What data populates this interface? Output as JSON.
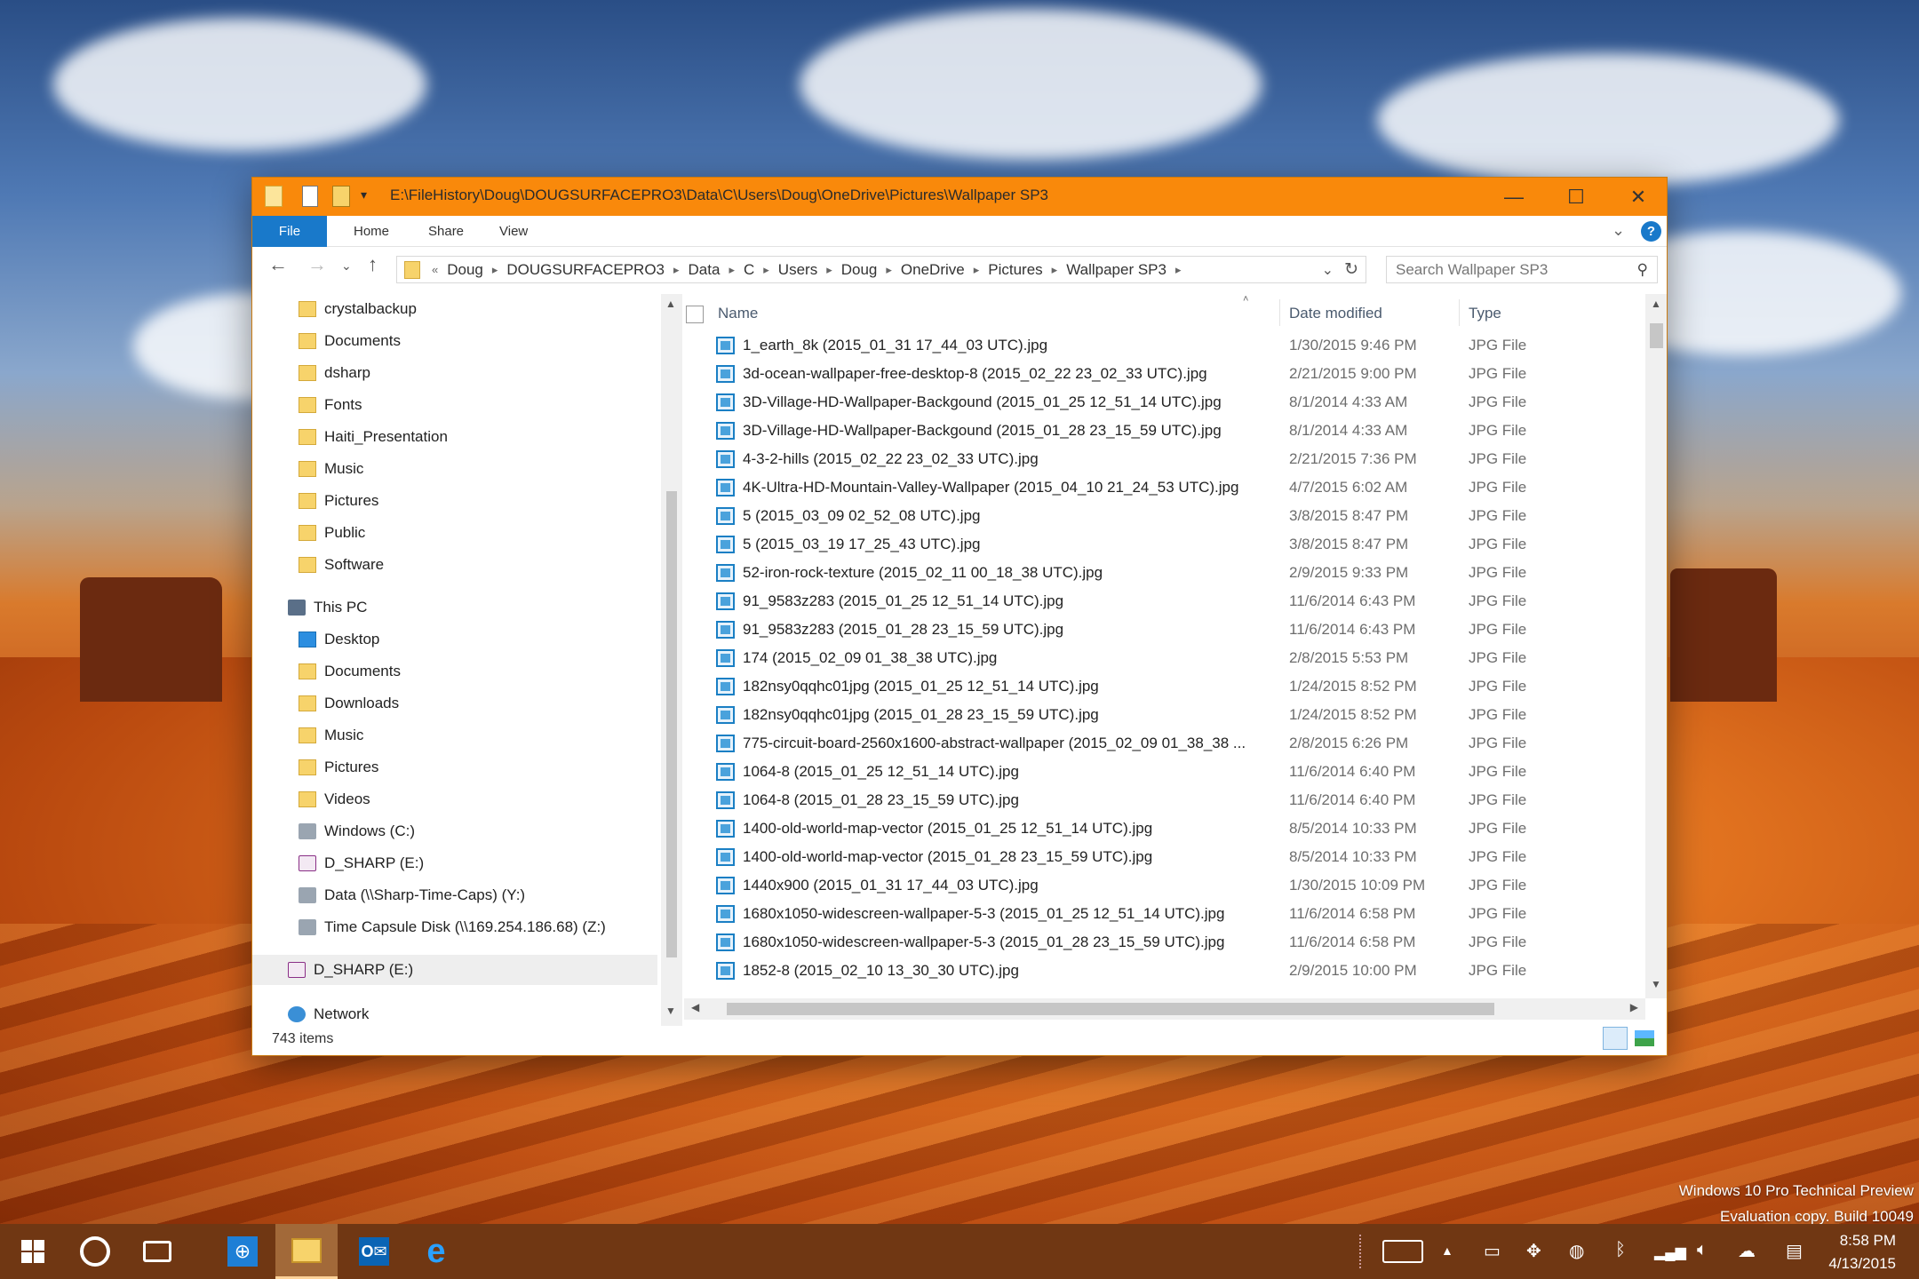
{
  "window": {
    "title_path": "E:\\FileHistory\\Doug\\DOUGSURFACEPRO3\\Data\\C\\Users\\Doug\\OneDrive\\Pictures\\Wallpaper SP3",
    "controls": {
      "minimize": "—",
      "maximize": "☐",
      "close": "✕"
    }
  },
  "ribbon": {
    "tabs": [
      "File",
      "Home",
      "Share",
      "View"
    ],
    "help": "?"
  },
  "address": {
    "overflow": "«",
    "crumbs": [
      "Doug",
      "DOUGSURFACEPRO3",
      "Data",
      "C",
      "Users",
      "Doug",
      "OneDrive",
      "Pictures",
      "Wallpaper SP3"
    ],
    "search_placeholder": "Search Wallpaper SP3"
  },
  "nav": {
    "folders": [
      "crystalbackup",
      "Documents",
      "dsharp",
      "Fonts",
      "Haiti_Presentation",
      "Music",
      "Pictures",
      "Public",
      "Software"
    ],
    "this_pc": "This PC",
    "pc_items": [
      "Desktop",
      "Documents",
      "Downloads",
      "Music",
      "Pictures",
      "Videos"
    ],
    "drives": [
      "Windows (C:)",
      "D_SHARP (E:)",
      "Data (\\\\Sharp-Time-Caps) (Y:)",
      "Time Capsule Disk (\\\\169.254.186.68) (Z:)"
    ],
    "selected_drive": "D_SHARP (E:)",
    "network": "Network"
  },
  "files": {
    "columns": {
      "name": "Name",
      "date": "Date modified",
      "type": "Type"
    },
    "rows": [
      {
        "name": "1_earth_8k (2015_01_31 17_44_03 UTC).jpg",
        "date": "1/30/2015 9:46 PM",
        "type": "JPG File"
      },
      {
        "name": "3d-ocean-wallpaper-free-desktop-8 (2015_02_22 23_02_33 UTC).jpg",
        "date": "2/21/2015 9:00 PM",
        "type": "JPG File"
      },
      {
        "name": "3D-Village-HD-Wallpaper-Backgound (2015_01_25 12_51_14 UTC).jpg",
        "date": "8/1/2014 4:33 AM",
        "type": "JPG File"
      },
      {
        "name": "3D-Village-HD-Wallpaper-Backgound (2015_01_28 23_15_59 UTC).jpg",
        "date": "8/1/2014 4:33 AM",
        "type": "JPG File"
      },
      {
        "name": "4-3-2-hills (2015_02_22 23_02_33 UTC).jpg",
        "date": "2/21/2015 7:36 PM",
        "type": "JPG File"
      },
      {
        "name": "4K-Ultra-HD-Mountain-Valley-Wallpaper (2015_04_10 21_24_53 UTC).jpg",
        "date": "4/7/2015 6:02 AM",
        "type": "JPG File"
      },
      {
        "name": "5 (2015_03_09 02_52_08 UTC).jpg",
        "date": "3/8/2015 8:47 PM",
        "type": "JPG File"
      },
      {
        "name": "5 (2015_03_19 17_25_43 UTC).jpg",
        "date": "3/8/2015 8:47 PM",
        "type": "JPG File"
      },
      {
        "name": "52-iron-rock-texture (2015_02_11 00_18_38 UTC).jpg",
        "date": "2/9/2015 9:33 PM",
        "type": "JPG File"
      },
      {
        "name": "91_9583z283 (2015_01_25 12_51_14 UTC).jpg",
        "date": "11/6/2014 6:43 PM",
        "type": "JPG File"
      },
      {
        "name": "91_9583z283 (2015_01_28 23_15_59 UTC).jpg",
        "date": "11/6/2014 6:43 PM",
        "type": "JPG File"
      },
      {
        "name": "174 (2015_02_09 01_38_38 UTC).jpg",
        "date": "2/8/2015 5:53 PM",
        "type": "JPG File"
      },
      {
        "name": "182nsy0qqhc01jpg (2015_01_25 12_51_14 UTC).jpg",
        "date": "1/24/2015 8:52 PM",
        "type": "JPG File"
      },
      {
        "name": "182nsy0qqhc01jpg (2015_01_28 23_15_59 UTC).jpg",
        "date": "1/24/2015 8:52 PM",
        "type": "JPG File"
      },
      {
        "name": "775-circuit-board-2560x1600-abstract-wallpaper (2015_02_09 01_38_38 ...",
        "date": "2/8/2015 6:26 PM",
        "type": "JPG File"
      },
      {
        "name": "1064-8 (2015_01_25 12_51_14 UTC).jpg",
        "date": "11/6/2014 6:40 PM",
        "type": "JPG File"
      },
      {
        "name": "1064-8 (2015_01_28 23_15_59 UTC).jpg",
        "date": "11/6/2014 6:40 PM",
        "type": "JPG File"
      },
      {
        "name": "1400-old-world-map-vector (2015_01_25 12_51_14 UTC).jpg",
        "date": "8/5/2014 10:33 PM",
        "type": "JPG File"
      },
      {
        "name": "1400-old-world-map-vector (2015_01_28 23_15_59 UTC).jpg",
        "date": "8/5/2014 10:33 PM",
        "type": "JPG File"
      },
      {
        "name": "1440x900 (2015_01_31 17_44_03 UTC).jpg",
        "date": "1/30/2015 10:09 PM",
        "type": "JPG File"
      },
      {
        "name": "1680x1050-widescreen-wallpaper-5-3 (2015_01_25 12_51_14 UTC).jpg",
        "date": "11/6/2014 6:58 PM",
        "type": "JPG File"
      },
      {
        "name": "1680x1050-widescreen-wallpaper-5-3 (2015_01_28 23_15_59 UTC).jpg",
        "date": "11/6/2014 6:58 PM",
        "type": "JPG File"
      },
      {
        "name": "1852-8 (2015_02_10 13_30_30 UTC).jpg",
        "date": "2/9/2015 10:00 PM",
        "type": "JPG File"
      }
    ]
  },
  "status": {
    "items": "743 items"
  },
  "watermark": {
    "line1": "Windows 10 Pro Technical Preview",
    "line2": "Evaluation copy. Build 10049"
  },
  "taskbar": {
    "apps": [
      "start-icon",
      "cortana-icon",
      "task-view-icon",
      "globe-app-icon",
      "file-explorer-icon",
      "outlook-icon",
      "internet-explorer-icon"
    ],
    "clock": {
      "time": "8:58 PM",
      "date": "4/13/2015"
    }
  },
  "colors": {
    "titlebar": "#f9890b",
    "file_tab": "#1979ca",
    "taskbar": "#6e3714",
    "file_icon": "#1a7fc4"
  }
}
